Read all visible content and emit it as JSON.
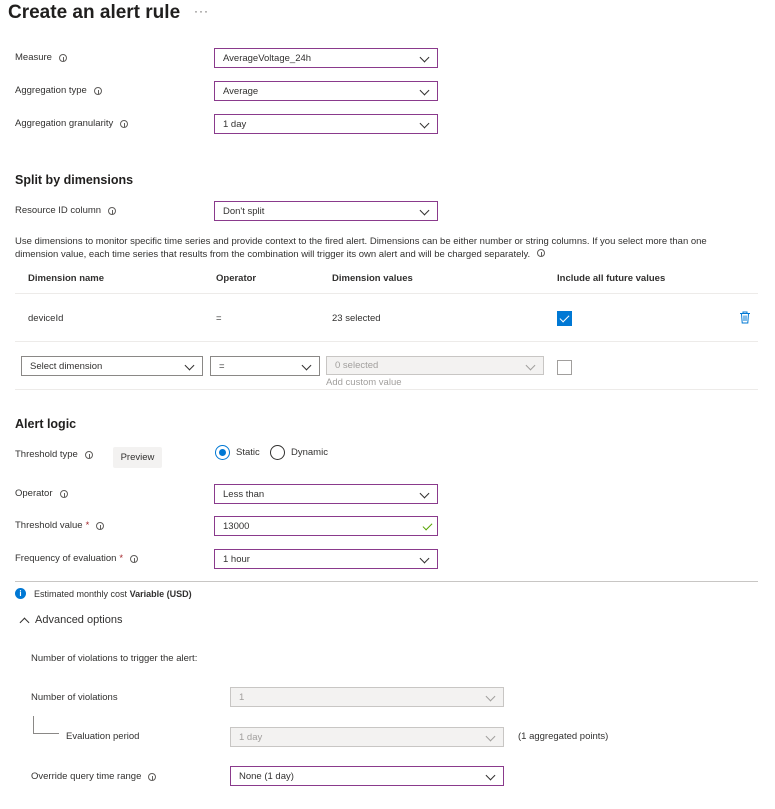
{
  "page": {
    "title": "Create an alert rule",
    "more": "···"
  },
  "measure": {
    "measure_label": "Measure",
    "measure_value": "AverageVoltage_24h",
    "agg_type_label": "Aggregation type",
    "agg_type_value": "Average",
    "granularity_label": "Aggregation granularity",
    "granularity_value": "1 day"
  },
  "split": {
    "heading": "Split by dimensions",
    "resource_label": "Resource ID column",
    "resource_value": "Don't split",
    "help": "Use dimensions to monitor specific time series and provide context to the fired alert. Dimensions can be either number or string columns. If you select more than one dimension value, each time series that results from the combination will trigger its own alert and will be charged separately.",
    "columns": [
      "Dimension name",
      "Operator",
      "Dimension values",
      "Include all future values"
    ],
    "row": {
      "name": "deviceId",
      "operator": "=",
      "values": "23 selected",
      "include_future": true
    },
    "new_row": {
      "dimension_placeholder": "Select dimension",
      "operator": "=",
      "values_placeholder": "0 selected",
      "add_custom": "Add custom value"
    }
  },
  "alert": {
    "heading": "Alert logic",
    "threshold_type_label": "Threshold type",
    "preview": "Preview",
    "static": "Static",
    "dynamic": "Dynamic",
    "selected": "Static",
    "operator_label": "Operator",
    "operator_value": "Less than",
    "threshold_label": "Threshold value",
    "threshold_value": "13000",
    "frequency_label": "Frequency of evaluation",
    "frequency_value": "1 hour",
    "required_mark": "*"
  },
  "cost": {
    "text": "Estimated monthly cost",
    "value": "Variable (USD)"
  },
  "advanced": {
    "heading": "Advanced options",
    "violations_title": "Number of violations to trigger the alert:",
    "violations_label": "Number of violations",
    "violations_value": "1",
    "period_label": "Evaluation period",
    "period_value": "1 day",
    "period_note": "(1 aggregated points)",
    "override_label": "Override query time range",
    "override_value": "None (1 day)"
  },
  "colors": {
    "accent": "#0078d4",
    "field_border": "#8a3a8c",
    "success": "#57a300"
  }
}
